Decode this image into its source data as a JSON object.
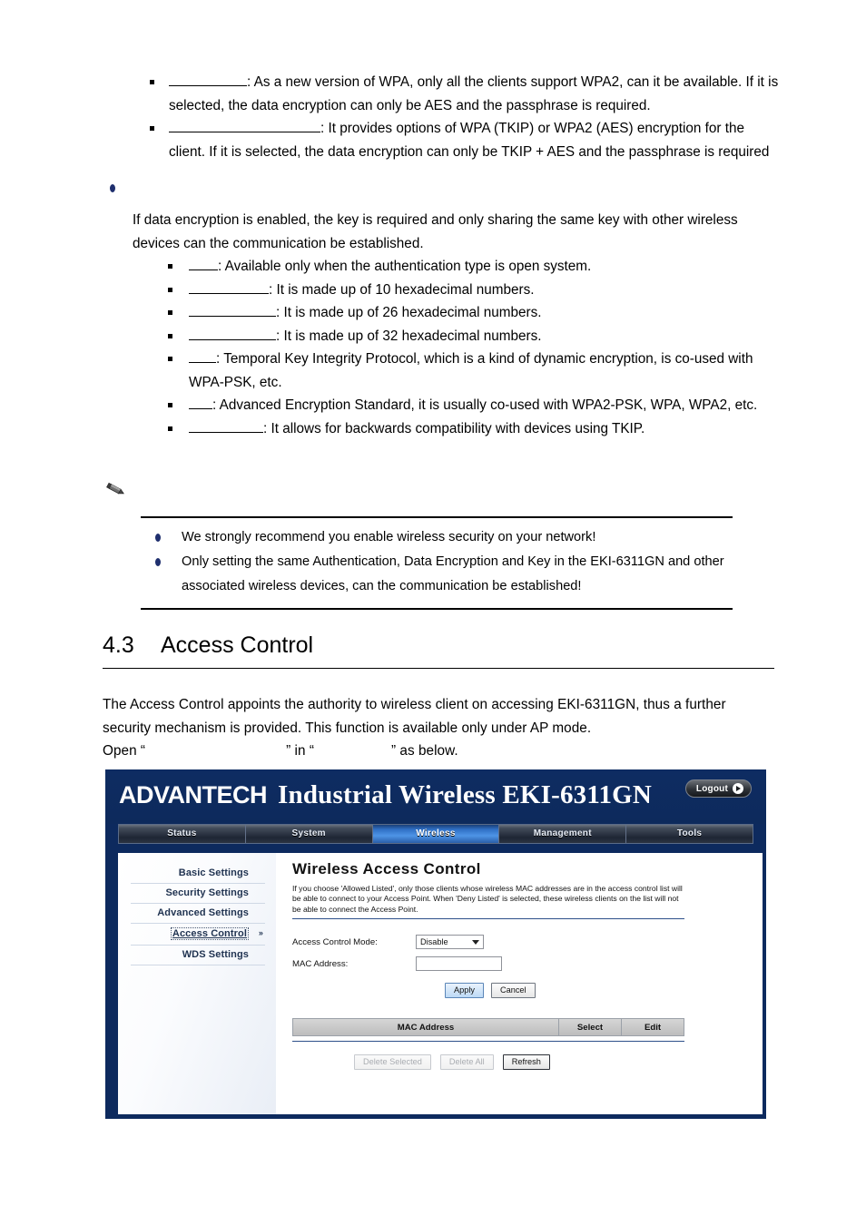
{
  "document": {
    "bullets_top": [
      {
        "blank_width": 86,
        "text": ": As a new version of WPA, only all the clients support WPA2, can it be available. If it is selected, the data encryption can only be AES and the passphrase is required."
      },
      {
        "blank_width": 167,
        "text": ": It provides options of WPA (TKIP) or WPA2 (AES) encryption for the client. If it is selected, the data encryption can only be TKIP + AES and the passphrase is required"
      }
    ],
    "key_section": {
      "lead_blank_width": 0,
      "paragraph": "If data encryption is enabled, the key is required and only sharing the same key with other wireless devices can the communication be established.",
      "items": [
        {
          "blank_width": 32,
          "text": ": Available only when the authentication type is open system."
        },
        {
          "blank_width": 88,
          "text": ": It is made up of 10 hexadecimal numbers."
        },
        {
          "blank_width": 96,
          "text": ": It is made up of 26 hexadecimal numbers."
        },
        {
          "blank_width": 96,
          "text": ": It is made up of 32 hexadecimal numbers."
        },
        {
          "blank_width": 30,
          "text": ": Temporal Key Integrity Protocol, which is a kind of dynamic encryption, is co-used with WPA-PSK, etc."
        },
        {
          "blank_width": 26,
          "text": ": Advanced Encryption Standard, it is usually co-used with WPA2-PSK, WPA, WPA2, etc."
        },
        {
          "blank_width": 82,
          "text": ": It allows for backwards compatibility with devices using TKIP."
        }
      ]
    },
    "note": {
      "icon": "pencil-icon",
      "lines": [
        "We strongly recommend you enable wireless security on your network!",
        "Only setting the same Authentication, Data Encryption and Key in the EKI-6311GN and other associated wireless devices, can the communication be established!"
      ]
    },
    "section": {
      "number": "4.3",
      "title": "Access Control"
    },
    "intro": {
      "paragraph": "The Access Control appoints the authority to wireless client on accessing EKI-6311GN, thus a further security mechanism is provided. This function is available only under AP mode.",
      "open_prefix": "Open “",
      "open_blank1_width": 155,
      "open_mid": "” in “",
      "open_blank2_width": 85,
      "open_suffix": "” as below."
    }
  },
  "screenshot": {
    "header": {
      "brand": "ADVANTECH",
      "product": "Industrial Wireless EKI-6311GN",
      "logout_label": "Logout",
      "logout_icon": "play-arrow-icon",
      "bg_color": "#0d2a5e"
    },
    "nav": {
      "items": [
        {
          "label": "Status",
          "active": false
        },
        {
          "label": "System",
          "active": false
        },
        {
          "label": "Wireless",
          "active": true
        },
        {
          "label": "Management",
          "active": false
        },
        {
          "label": "Tools",
          "active": false
        }
      ],
      "active_color": "#3a7fd5"
    },
    "sidebar": {
      "items": [
        {
          "label": "Basic Settings",
          "selected": false,
          "chevron": ""
        },
        {
          "label": "Security Settings",
          "selected": false,
          "chevron": ""
        },
        {
          "label": "Advanced Settings",
          "selected": false,
          "chevron": ""
        },
        {
          "label": "Access Control",
          "selected": true,
          "chevron": "»"
        },
        {
          "label": "WDS Settings",
          "selected": false,
          "chevron": ""
        }
      ]
    },
    "content": {
      "title": "Wireless Access Control",
      "description": "If you choose 'Allowed Listed', only those clients whose wireless MAC addresses are in the access control list will be able to connect to your Access Point. When 'Deny Listed' is selected, these wireless clients on the list will not be able to connect the Access Point.",
      "form": {
        "mode_label": "Access Control Mode:",
        "mode_value": "Disable",
        "mac_label": "MAC Address:",
        "mac_value": "",
        "apply_label": "Apply",
        "cancel_label": "Cancel"
      },
      "table": {
        "headers": [
          "MAC Address",
          "Select",
          "Edit"
        ],
        "rows": []
      },
      "table_actions": [
        {
          "label": "Delete Selected",
          "disabled": true
        },
        {
          "label": "Delete All",
          "disabled": true
        },
        {
          "label": "Refresh",
          "disabled": false
        }
      ]
    }
  }
}
